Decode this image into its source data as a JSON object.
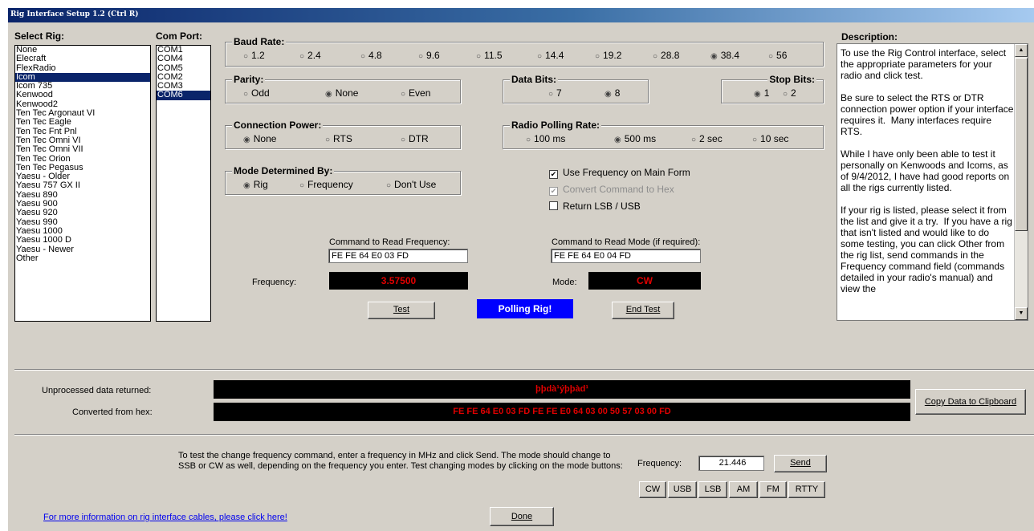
{
  "window": {
    "title": "Rig Interface Setup 1.2   (Ctrl R)"
  },
  "select_rig": {
    "label": "Select Rig:",
    "items": [
      "None",
      "Elecraft",
      "FlexRadio",
      "Icom",
      "Icom 735",
      "Kenwood",
      "Kenwood2",
      "Ten Tec Argonaut VI",
      "Ten Tec Eagle",
      "Ten Tec Fnt Pnl",
      "Ten Tec Omni VI",
      "Ten Tec Omni VII",
      "Ten Tec Orion",
      "Ten Tec Pegasus",
      "Yaesu - Older",
      "Yaesu 757 GX II",
      "Yaesu 890",
      "Yaesu 900",
      "Yaesu 920",
      "Yaesu 990",
      "Yaesu 1000",
      "Yaesu 1000 D",
      "Yaesu - Newer",
      "Other"
    ],
    "selected": "Icom"
  },
  "com_port": {
    "label": "Com Port:",
    "items": [
      "COM1",
      "COM4",
      "COM5",
      "COM2",
      "COM3",
      "COM6"
    ],
    "selected": "COM6"
  },
  "baud_rate": {
    "label": "Baud Rate:",
    "options": [
      "1.2",
      "2.4",
      "4.8",
      "9.6",
      "11.5",
      "14.4",
      "19.2",
      "28.8",
      "38.4",
      "56"
    ],
    "selected": "38.4"
  },
  "parity": {
    "label": "Parity:",
    "options": [
      "Odd",
      "None",
      "Even"
    ],
    "selected": "None"
  },
  "data_bits": {
    "label": "Data Bits:",
    "options": [
      "7",
      "8"
    ],
    "selected": "8"
  },
  "stop_bits": {
    "label": "Stop Bits:",
    "options": [
      "1",
      "2"
    ],
    "selected": "1"
  },
  "connection_power": {
    "label": "Connection Power:",
    "options": [
      "None",
      "RTS",
      "DTR"
    ],
    "selected": "None"
  },
  "polling_rate": {
    "label": "Radio Polling Rate:",
    "options": [
      "100 ms",
      "500 ms",
      "2 sec",
      "10 sec"
    ],
    "selected": "500 ms"
  },
  "mode_determined": {
    "label": "Mode Determined By:",
    "options": [
      "Rig",
      "Frequency",
      "Don't Use"
    ],
    "selected": "Rig"
  },
  "checks": {
    "use_frequency": {
      "label": "Use Frequency on Main Form",
      "checked": true,
      "enabled": true
    },
    "convert_hex": {
      "label": "Convert Command to Hex",
      "checked": true,
      "enabled": false
    },
    "return_lsb": {
      "label": "Return LSB / USB",
      "checked": false,
      "enabled": true
    }
  },
  "read_freq": {
    "label": "Command to Read Frequency:",
    "value": "FE FE 64 E0 03 FD"
  },
  "read_mode": {
    "label": "Command to Read Mode (if required):",
    "value": "FE FE 64 E0 04 FD"
  },
  "frequency_display": {
    "label": "Frequency:",
    "value": "3.57500"
  },
  "mode_display": {
    "label": "Mode:",
    "value": "CW"
  },
  "buttons": {
    "test": "Test",
    "end_test": "End Test",
    "copy": "Copy Data to Clipboard",
    "send": "Send",
    "done": "Done"
  },
  "polling_status": {
    "text": "Polling Rig!",
    "color": "#0000ff"
  },
  "description": {
    "label": "Description:",
    "text": "To use the Rig Control interface, select the appropriate parameters for your radio and click test.\n\nBe sure to select the RTS or DTR connection power option if your interface requires it.  Many interfaces require RTS.\n\nWhile I have only been able to test it personally on Kenwoods and Icoms, as of 9/4/2012, I have had good reports on all the rigs currently listed.\n\nIf your rig is listed, please select it from the list and give it a try.  If you have a rig that isn't listed and would like to do some testing, you can click Other from the rig list, send commands in the Frequency command field (commands detailed in your radio's manual) and view the"
  },
  "unprocessed": {
    "label": "Unprocessed data returned:",
    "value": "þþdà¹ýþþàd¹"
  },
  "converted": {
    "label": "Converted from hex:",
    "value": "FE FE 64 E0 03 FD FE FE E0 64 03 00 50 57 03 00 FD"
  },
  "change_freq": {
    "instructions": "To test the change frequency command, enter a frequency in MHz and click Send.  The mode should change to SSB or CW as well, depending on the frequency you enter.  Test changing modes by clicking on the mode buttons:",
    "freq_label": "Frequency:",
    "freq_value": "21.446",
    "modes": [
      "CW",
      "USB",
      "LSB",
      "AM",
      "FM",
      "RTTY"
    ]
  },
  "info_link": "For more information on rig interface cables, please click here!"
}
